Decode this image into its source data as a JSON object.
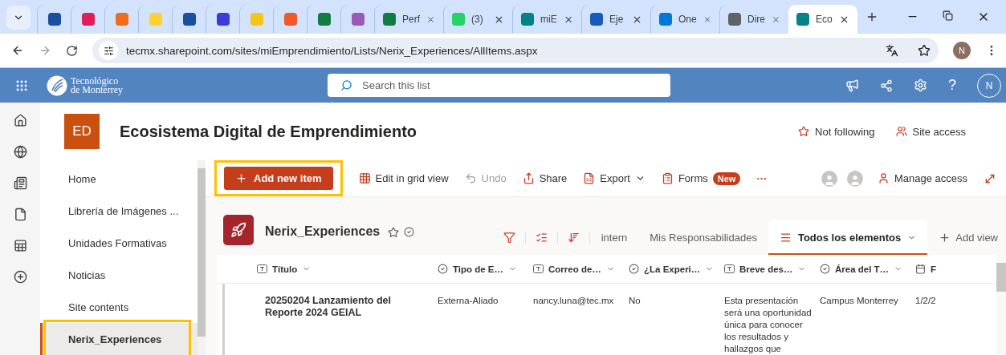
{
  "browser": {
    "tabs": [
      {
        "selected": false
      },
      {
        "selected": false
      },
      {
        "selected": false
      },
      {
        "selected": false
      },
      {
        "selected": false
      },
      {
        "selected": false
      },
      {
        "selected": false
      },
      {
        "selected": false
      },
      {
        "selected": false
      },
      {
        "selected": false
      },
      {
        "title": "Perf",
        "selected": false
      },
      {
        "title": "(3)",
        "selected": false
      },
      {
        "title": "miE",
        "selected": false
      },
      {
        "title": "Eje",
        "selected": false
      },
      {
        "title": "One",
        "selected": false
      },
      {
        "title": "Dire",
        "selected": false
      },
      {
        "title": "Eco",
        "selected": true
      }
    ],
    "url": "tecmx.sharepoint.com/sites/miEmprendimiento/Lists/Nerix_Experiences/AllItems.aspx",
    "profile_initial": "N"
  },
  "suite_bar": {
    "brand": [
      "Tecnológico",
      "de Monterrey"
    ],
    "search": {
      "placeholder": "Search this list"
    },
    "help": "?",
    "avatar_initial": "N"
  },
  "site": {
    "logo": "ED",
    "title": "Ecosistema Digital de Emprendimiento",
    "following": false,
    "follow_label": "Not following",
    "access_label": "Site access"
  },
  "nav": [
    {
      "label": "Home",
      "selected": false,
      "highlighted": false
    },
    {
      "label": "Librería de Imágenes ...",
      "selected": false,
      "highlighted": false
    },
    {
      "label": "Unidades Formativas",
      "selected": false,
      "highlighted": false
    },
    {
      "label": "Noticias",
      "selected": false,
      "highlighted": false
    },
    {
      "label": "Site contents",
      "selected": false,
      "highlighted": false
    },
    {
      "label": "Nerix_Experiences",
      "selected": true,
      "highlighted": true
    }
  ],
  "commands": [
    {
      "kind": "primary",
      "label": "Add new item",
      "highlighted": true,
      "disabled": false
    },
    {
      "kind": "command",
      "label": "Edit in grid view",
      "disabled": false
    },
    {
      "kind": "command",
      "label": "Undo",
      "disabled": true
    },
    {
      "kind": "command",
      "label": "Share",
      "disabled": false
    },
    {
      "kind": "dropdown",
      "label": "Export",
      "disabled": false
    },
    {
      "kind": "badge",
      "label": "Forms",
      "badge": "New",
      "disabled": false
    },
    {
      "kind": "more",
      "label": "···",
      "disabled": false
    }
  ],
  "manage_access": "Manage access",
  "list": {
    "title": "Nerix_Experiences",
    "favorite": false,
    "views": [
      {
        "label": "intern",
        "selected": false
      },
      {
        "label": "Mis Responsabilidades",
        "selected": false
      },
      {
        "label": "Todos los elementos",
        "selected": true
      }
    ],
    "add_view": "Add view",
    "columns": [
      {
        "label": "Título",
        "kind": "text"
      },
      {
        "label": "Tipo de E…",
        "kind": "choice"
      },
      {
        "label": "Correo de…",
        "kind": "text"
      },
      {
        "label": "¿La Experi…",
        "kind": "choice"
      },
      {
        "label": "Breve des…",
        "kind": "text"
      },
      {
        "label": "Área del T…",
        "kind": "choice"
      },
      {
        "label": "F",
        "kind": "date"
      }
    ],
    "rows": [
      {
        "cells": [
          "20250204 Lanzamiento del Reporte 2024 GEIAL",
          "Externa-Aliado",
          "nancy.luna@tec.mx",
          "No",
          "Esta presentación será una oportunidad única para conocer los resultados y hallazgos que",
          "Campus Monterrey",
          "1/2/2"
        ]
      }
    ]
  }
}
